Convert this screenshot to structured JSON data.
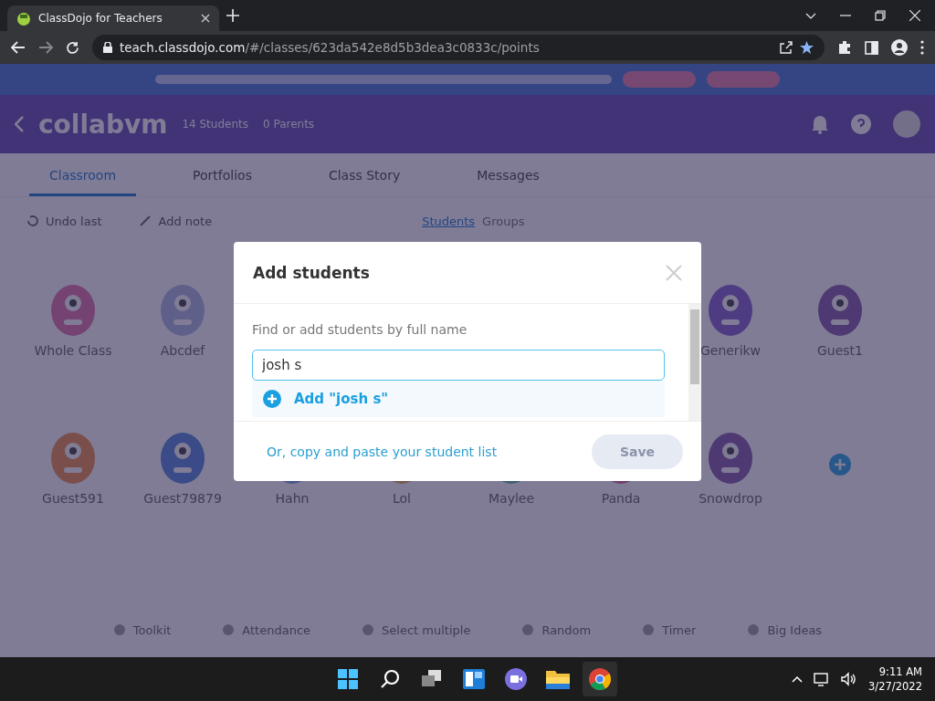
{
  "browser": {
    "tab_title": "ClassDojo for Teachers",
    "url_host": "teach.classdojo.com",
    "url_path": "/#/classes/623da542e8d5b3dea3c0833c/points"
  },
  "header": {
    "class_name": "collabvm",
    "students": "14 Students",
    "parents": "0 Parents"
  },
  "nav_tabs": [
    {
      "label": "Classroom",
      "selected": true
    },
    {
      "label": "Portfolios",
      "selected": false
    },
    {
      "label": "Class Story",
      "selected": false
    },
    {
      "label": "Messages",
      "selected": false
    }
  ],
  "actions": [
    "Undo last",
    "Add note"
  ],
  "view_toggle": [
    {
      "label": "Students",
      "selected": true
    },
    {
      "label": "Groups",
      "selected": false
    }
  ],
  "students_row_1": [
    "Whole Class",
    "Abcdef",
    "Generikw",
    "Guest1"
  ],
  "students_row_2": [
    "Guest591",
    "Guest79879",
    "Hahn",
    "Lol",
    "Maylee",
    "Panda",
    "Snowdrop"
  ],
  "toolbar": [
    "Toolkit",
    "Attendance",
    "Select multiple",
    "Random",
    "Timer",
    "Big Ideas"
  ],
  "modal": {
    "title": "Add students",
    "label": "Find or add students by full name",
    "value": "josh s",
    "suggestion": "Add \"josh s\"",
    "paste_link": "Or, copy and paste your student list",
    "save": {
      "label": "Save",
      "disabled": true
    }
  },
  "taskbar": {
    "time": "9:11 AM",
    "date": "3/27/2022"
  }
}
